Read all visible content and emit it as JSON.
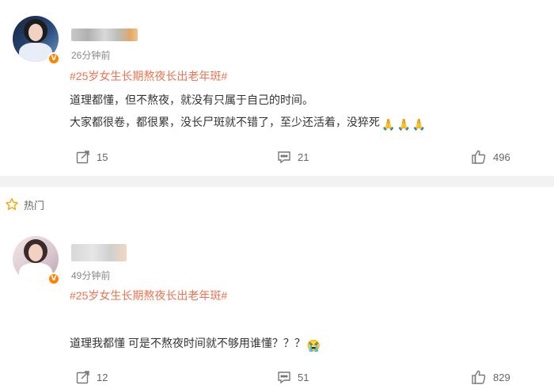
{
  "colors": {
    "hashtag": "#eb7350",
    "verified_badge": "#ff8200",
    "muted_text": "#888888",
    "divider": "#f2f2f2"
  },
  "posts": [
    {
      "time": "26分钟前",
      "hashtag": "#25岁女生长期熬夜长出老年斑#",
      "lines": [
        "道理都懂，但不熬夜，就没有只属于自己的时间。",
        "大家都很卷，都很累，没长尸斑就不错了，至少还活着，没猝死"
      ],
      "trailing_emojis": [
        "🙏",
        "🙏",
        "🙏"
      ],
      "actions": {
        "share_count": "15",
        "comment_count": "21",
        "like_count": "496"
      }
    },
    {
      "time": "49分钟前",
      "hashtag": "#25岁女生长期熬夜长出老年斑#",
      "lines": [
        "道理我都懂 可是不熬夜时间就不够用谁懂？？？"
      ],
      "trailing_emojis": [
        "😭"
      ],
      "actions": {
        "share_count": "12",
        "comment_count": "51",
        "like_count": "829"
      }
    }
  ],
  "section": {
    "hot_label": "热门",
    "hot_icon": "star-outline-icon"
  },
  "icons": {
    "share": "share-icon",
    "comment": "comment-icon",
    "like": "thumbs-up-icon",
    "verified": "verified-v-icon"
  },
  "verified_badge_text": "V"
}
